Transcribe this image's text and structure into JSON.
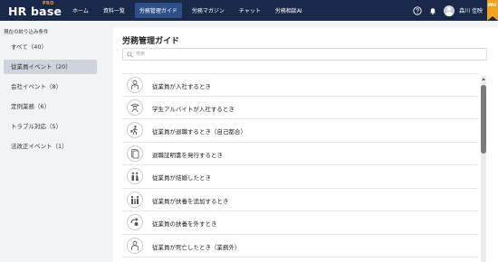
{
  "header": {
    "logo_text": "HR base",
    "logo_pro": "PRO",
    "nav": [
      {
        "label": "ホーム",
        "active": false
      },
      {
        "label": "資料一覧",
        "active": false
      },
      {
        "label": "労務管理ガイド",
        "active": true
      },
      {
        "label": "労務マガジン",
        "active": false
      },
      {
        "label": "チャット",
        "active": false
      },
      {
        "label": "労務相談AI",
        "active": false
      }
    ],
    "icons": [
      "help-icon",
      "bell-icon"
    ],
    "username": "森川 佳映",
    "badge": "PRO"
  },
  "sidebar": {
    "title": "現在の絞り込み条件",
    "items": [
      {
        "label": "すべて（40）",
        "active": false
      },
      {
        "label": "従業員イベント（20）",
        "active": true
      },
      {
        "label": "会社イベント（8）",
        "active": false
      },
      {
        "label": "定例業務（6）",
        "active": false
      },
      {
        "label": "トラブル対応（5）",
        "active": false
      },
      {
        "label": "法改正イベント（1）",
        "active": false
      }
    ]
  },
  "main": {
    "title": "労務管理ガイド",
    "search_placeholder": "検索",
    "items": [
      {
        "label": "従業員が入社するとき",
        "icon": "person-icon"
      },
      {
        "label": "学生アルバイトが入社するとき",
        "icon": "student-icon"
      },
      {
        "label": "従業員が退職するとき（自己都合）",
        "icon": "walking-person-icon"
      },
      {
        "label": "退職証明書を発行するとき",
        "icon": "document-icon"
      },
      {
        "label": "従業員が結婚したとき",
        "icon": "couple-icon"
      },
      {
        "label": "従業員が扶養を追加するとき",
        "icon": "family-icon"
      },
      {
        "label": "従業員の扶養を外すとき",
        "icon": "remove-dependent-icon"
      },
      {
        "label": "従業員が死亡したとき（業務外）",
        "icon": "person-icon"
      }
    ]
  }
}
